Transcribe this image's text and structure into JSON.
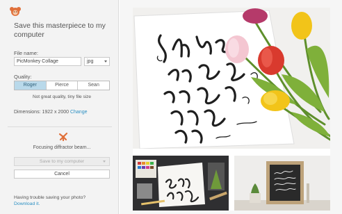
{
  "panel": {
    "title": "Save this masterpiece to my computer",
    "file_name_label": "File name:",
    "file_name_value": "PicMonkey Collage",
    "format_value": "jpg",
    "quality_label": "Quality:",
    "quality_options": [
      "Roger",
      "Pierce",
      "Sean"
    ],
    "quality_selected": "Roger",
    "quality_description": "Not great quality, tiny file size",
    "dimensions_label": "Dimensions:",
    "dimensions_value": "1922 x 2000",
    "change_link": "Change",
    "status_text": "Focusing diffractor beam...",
    "save_button": "Save to my computer",
    "cancel_button": "Cancel",
    "trouble_text": "Having trouble saving your photo?",
    "download_link": "Download it."
  },
  "colors": {
    "accent": "#e0703a",
    "link": "#2b8fc2",
    "selected_segment": "#b9d9ea"
  }
}
